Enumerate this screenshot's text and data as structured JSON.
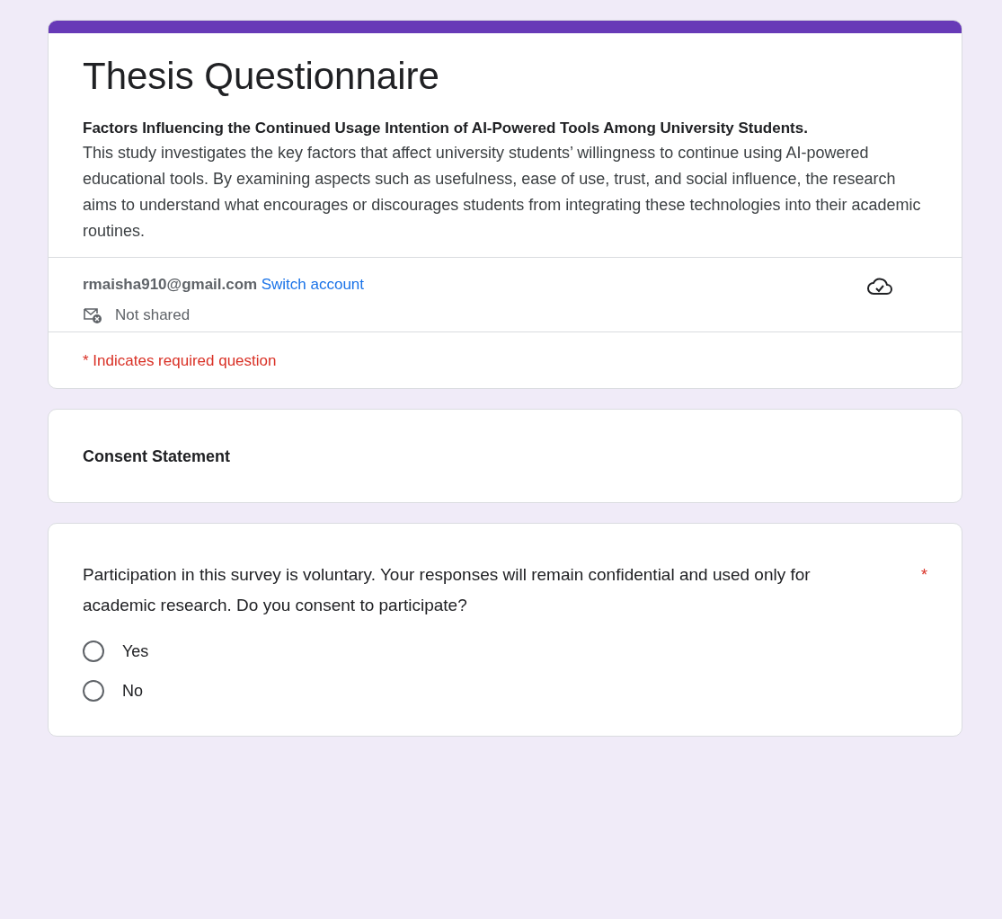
{
  "form": {
    "title": "Thesis Questionnaire",
    "subtitle": "Factors Influencing the Continued Usage Intention of AI-Powered Tools Among University Students.",
    "description": "This study investigates the key factors that affect university students’ willingness to continue using AI-powered educational tools. By examining aspects such as usefulness, ease of use, trust, and social influence, the research aims to understand what encourages or discourages students from integrating these technologies into their academic routines.",
    "account_email": "rmaisha910@gmail.com",
    "switch_account": "Switch account",
    "sharing_status": "Not shared",
    "required_note": "* Indicates required question"
  },
  "section": {
    "title": "Consent Statement"
  },
  "question": {
    "text": "Participation in this survey is voluntary. Your responses will remain confidential and used only for academic research. Do you consent to participate?",
    "required_mark": "*",
    "options": [
      {
        "label": "Yes",
        "selected": false
      },
      {
        "label": "No",
        "selected": false
      }
    ]
  }
}
